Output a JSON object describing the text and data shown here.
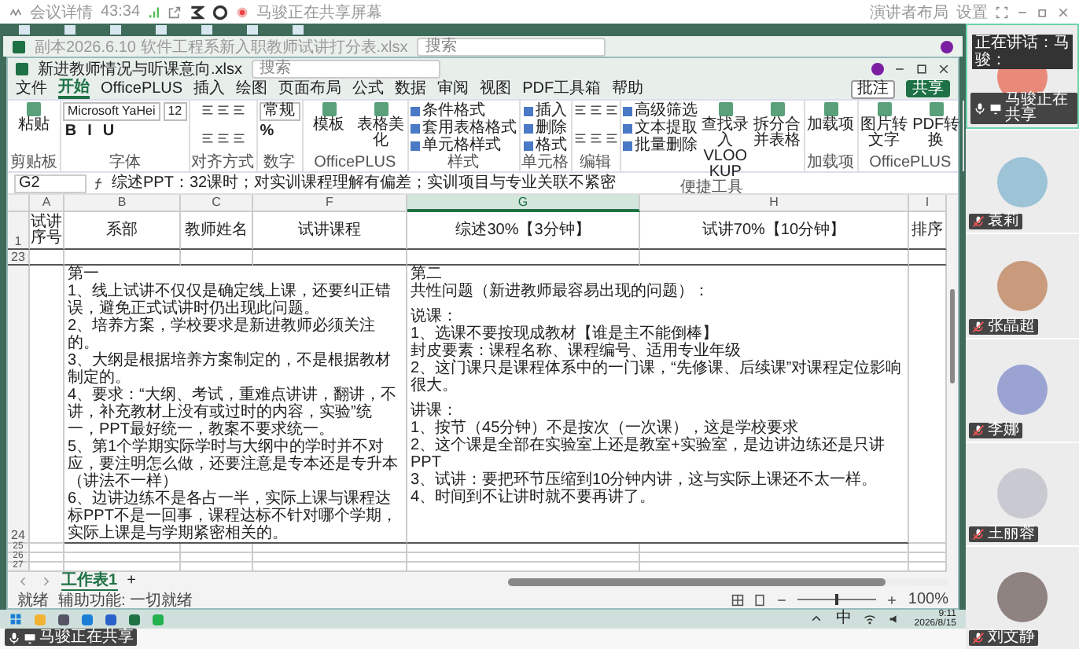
{
  "meeting": {
    "details": "会议详情",
    "duration": "43:34",
    "sharing_notice": "马骏正在共享屏幕",
    "layout_button": "演讲者布局",
    "settings_button": "设置",
    "footer_label": "马骏正在共享"
  },
  "outer_window": {
    "title": "副本2026.6.10 软件工程系新入职教师试讲打分表.xlsx",
    "search_placeholder": "搜索"
  },
  "excel": {
    "title": "新进教师情况与听课意向.xlsx",
    "search_placeholder": "搜索",
    "menu": [
      {
        "label": "文件",
        "selected": false
      },
      {
        "label": "开始",
        "selected": true
      },
      {
        "label": "OfficePLUS",
        "selected": false
      },
      {
        "label": "插入",
        "selected": false
      },
      {
        "label": "绘图",
        "selected": false
      },
      {
        "label": "页面布局",
        "selected": false
      },
      {
        "label": "公式",
        "selected": false
      },
      {
        "label": "数据",
        "selected": false
      },
      {
        "label": "审阅",
        "selected": false
      },
      {
        "label": "视图",
        "selected": false
      },
      {
        "label": "PDF工具箱",
        "selected": false
      },
      {
        "label": "帮助",
        "selected": false
      }
    ],
    "comment_button": "批注",
    "share_button": "共享",
    "ribbon": [
      {
        "label": "剪贴板",
        "kind": "columns",
        "columns": [
          [
            {
              "text": "粘贴",
              "kind": "large"
            }
          ]
        ]
      },
      {
        "label": "字体",
        "kind": "lines",
        "lines": [
          [
            {
              "text": "Microsoft YaHei",
              "kind": "font_field"
            },
            {
              "text": "12",
              "kind": "font_field"
            }
          ],
          [
            {
              "text": "B",
              "kind": "button"
            },
            {
              "text": "I",
              "kind": "button"
            },
            {
              "text": "U",
              "kind": "button"
            }
          ]
        ]
      },
      {
        "label": "对齐方式",
        "kind": "icons"
      },
      {
        "label": "数字",
        "kind": "lines",
        "lines": [
          [
            {
              "text": "常规",
              "kind": "field"
            }
          ],
          [
            {
              "text": "%",
              "kind": "button"
            }
          ]
        ]
      },
      {
        "label": "OfficePLUS",
        "kind": "columns",
        "columns": [
          [
            {
              "text": "模板",
              "kind": "large"
            }
          ],
          [
            {
              "text": "表格美化",
              "kind": "large"
            }
          ]
        ]
      },
      {
        "label": "样式",
        "kind": "columns",
        "columns": [
          [
            {
              "text": "条件格式",
              "kind": "small"
            },
            {
              "text": "套用表格格式",
              "kind": "small"
            },
            {
              "text": "单元格样式",
              "kind": "small"
            }
          ]
        ]
      },
      {
        "label": "单元格",
        "kind": "columns",
        "columns": [
          [
            {
              "text": "插入",
              "kind": "small"
            },
            {
              "text": "删除",
              "kind": "small"
            },
            {
              "text": "格式",
              "kind": "small"
            }
          ]
        ]
      },
      {
        "label": "编辑",
        "kind": "icons"
      },
      {
        "label": "便捷工具",
        "kind": "columns",
        "columns": [
          [
            {
              "text": "高级筛选",
              "kind": "small"
            },
            {
              "text": "文本提取",
              "kind": "small"
            },
            {
              "text": "批量删除",
              "kind": "small"
            }
          ],
          [
            {
              "text": "查找录入VLOOKUP",
              "kind": "large"
            }
          ],
          [
            {
              "text": "拆分合并表格",
              "kind": "large"
            }
          ]
        ]
      },
      {
        "label": "加载项",
        "kind": "columns",
        "columns": [
          [
            {
              "text": "加载项",
              "kind": "large"
            }
          ]
        ]
      },
      {
        "label": "OfficePLUS",
        "kind": "columns",
        "columns": [
          [
            {
              "text": "图片转文字",
              "kind": "large"
            }
          ],
          [
            {
              "text": "PDF转换",
              "kind": "large"
            }
          ]
        ]
      }
    ],
    "name_box": "G2",
    "formula": "综述PPT：32课时；对实训课程理解有偏差；实训项目与专业关联不紧密",
    "columns": [
      {
        "label": "A",
        "selected": false
      },
      {
        "label": "B",
        "selected": false
      },
      {
        "label": "C",
        "selected": false
      },
      {
        "label": "F",
        "selected": false
      },
      {
        "label": "G",
        "selected": true
      },
      {
        "label": "H",
        "selected": false
      },
      {
        "label": "I",
        "selected": false
      }
    ],
    "header_row": {
      "number": "1",
      "cells": [
        "试讲序号",
        "系部",
        "教师姓名",
        "试讲课程",
        "综述30%【3分钟】",
        "试讲70%【10分钟】",
        "排序"
      ]
    },
    "empty_row": "23",
    "content_row": {
      "number": "24",
      "left_lines": [
        "第一",
        "1、线上试讲不仅仅是确定线上课，还要纠正错误，避免正式试讲时仍出现此问题。",
        "2、培养方案，学校要求是新进教师必须关注的。",
        "3、大纲是根据培养方案制定的，不是根据教材制定的。",
        "4、要求：“大纲、考试，重难点讲讲，翻讲，不讲，补充教材上没有或过时的内容，实验”统一，PPT最好统一，教案不要求统一。",
        "5、第1个学期实际学时与大纲中的学时并不对应，要注明怎么做，还要注意是专本还是专升本（讲法不一样）",
        "6、边讲边练不是各占一半，实际上课与课程达标PPT不是一回事，课程达标不针对哪个学期，实际上课是与学期紧密相关的。"
      ],
      "right_sections": [
        [
          "第二",
          "共性问题（新进教师最容易出现的问题）："
        ],
        [
          "说课：",
          "1、选课不要按现成教材【谁是主不能倒棒】",
          "封皮要素：课程名称、课程编号、适用专业年级",
          "2、这门课只是课程体系中的一门课，“先修课、后续课”对课程定位影响很大。"
        ],
        [
          "讲课：",
          "1、按节（45分钟）不是按次（一次课），这是学校要求",
          "2、这个课是全部在实验室上还是教室+实验室，是边讲边练还是只讲PPT",
          "3、试讲：要把环节压缩到10分钟内讲，这与实际上课还不太一样。",
          "4、时间到不让讲时就不要再讲了。"
        ]
      ]
    },
    "blank_rows": [
      "25",
      "26",
      "27"
    ],
    "sheet_tabs": [
      {
        "label": "工作表1",
        "selected": true
      }
    ],
    "add_sheet": "+",
    "status": {
      "ready": "就绪",
      "accessibility": "辅助功能: 一切就绪",
      "zoom": "100%",
      "zoom_slider": {
        "level": 0.5
      }
    }
  },
  "taskbar": {
    "ime": "中",
    "time": "9:11",
    "date": "2026/8/15"
  },
  "sidebar": {
    "speaker_banner": "正在讲话：马骏：",
    "participants": [
      {
        "name": "马骏正在共享",
        "active": true,
        "muted": false,
        "sharing": true
      },
      {
        "name": "袁莉",
        "active": false,
        "muted": true,
        "sharing": false
      },
      {
        "name": "张晶超",
        "active": false,
        "muted": true,
        "sharing": false
      },
      {
        "name": "李娜",
        "active": false,
        "muted": true,
        "sharing": false
      },
      {
        "name": "王丽蓉",
        "active": false,
        "muted": true,
        "sharing": false
      },
      {
        "name": "刘文静",
        "active": false,
        "muted": true,
        "sharing": false
      }
    ]
  }
}
